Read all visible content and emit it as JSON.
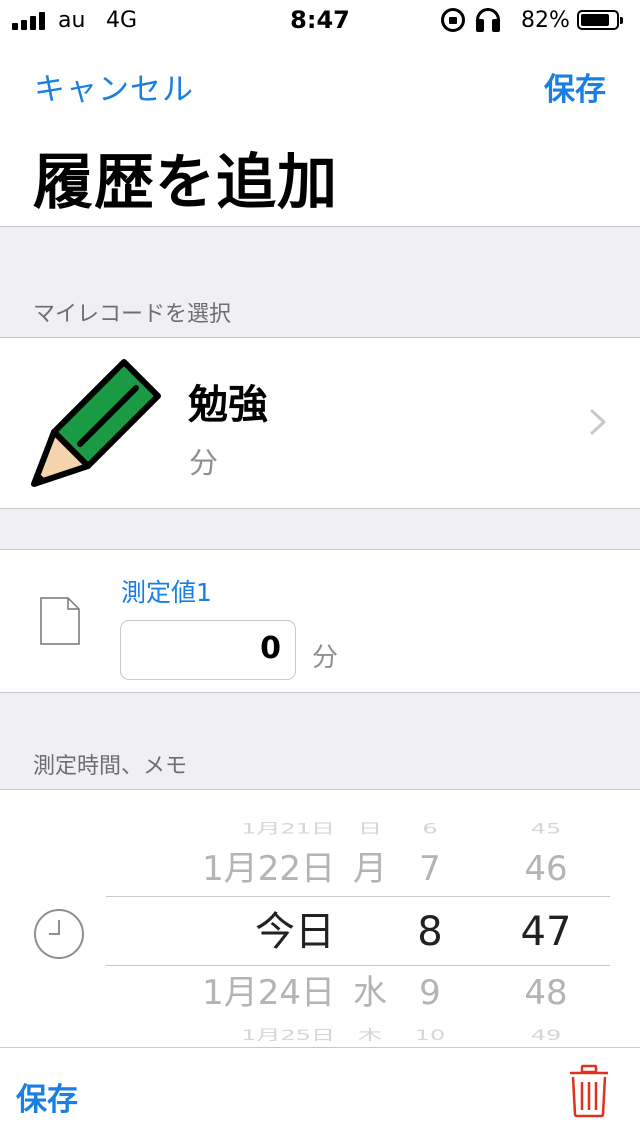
{
  "status_bar": {
    "carrier": "au",
    "network": "4G",
    "time": "8:47",
    "battery_percent": "82%",
    "battery_level": 0.82,
    "signal_bars": 4
  },
  "nav": {
    "cancel_label": "キャンセル",
    "save_label": "保存",
    "title": "履歴を追加"
  },
  "record_section": {
    "header": "マイレコードを選択",
    "record": {
      "name": "勉強",
      "unit": "分",
      "icon": "pencil-icon"
    }
  },
  "measurement": {
    "label": "測定値1",
    "value": "0",
    "unit": "分"
  },
  "memo_section": {
    "header": "測定時間、メモ"
  },
  "date_picker": {
    "dates": [
      "1月21日",
      "1月22日",
      "今日",
      "1月24日",
      "1月25日"
    ],
    "weekdays": [
      "日",
      "月",
      "",
      "水",
      "木"
    ],
    "hours": [
      "6",
      "7",
      "8",
      "9",
      "10"
    ],
    "minutes": [
      "45",
      "46",
      "47",
      "48",
      "49"
    ],
    "selected": {
      "date": "今日",
      "hour": "8",
      "minute": "47"
    }
  },
  "toolbar": {
    "save_label": "保存",
    "delete_icon": "trash-icon"
  },
  "colors": {
    "accent": "#1a7fe4",
    "delete": "#e0321e",
    "group_background": "#efeff4",
    "pencil_body": "#1a9a45"
  }
}
